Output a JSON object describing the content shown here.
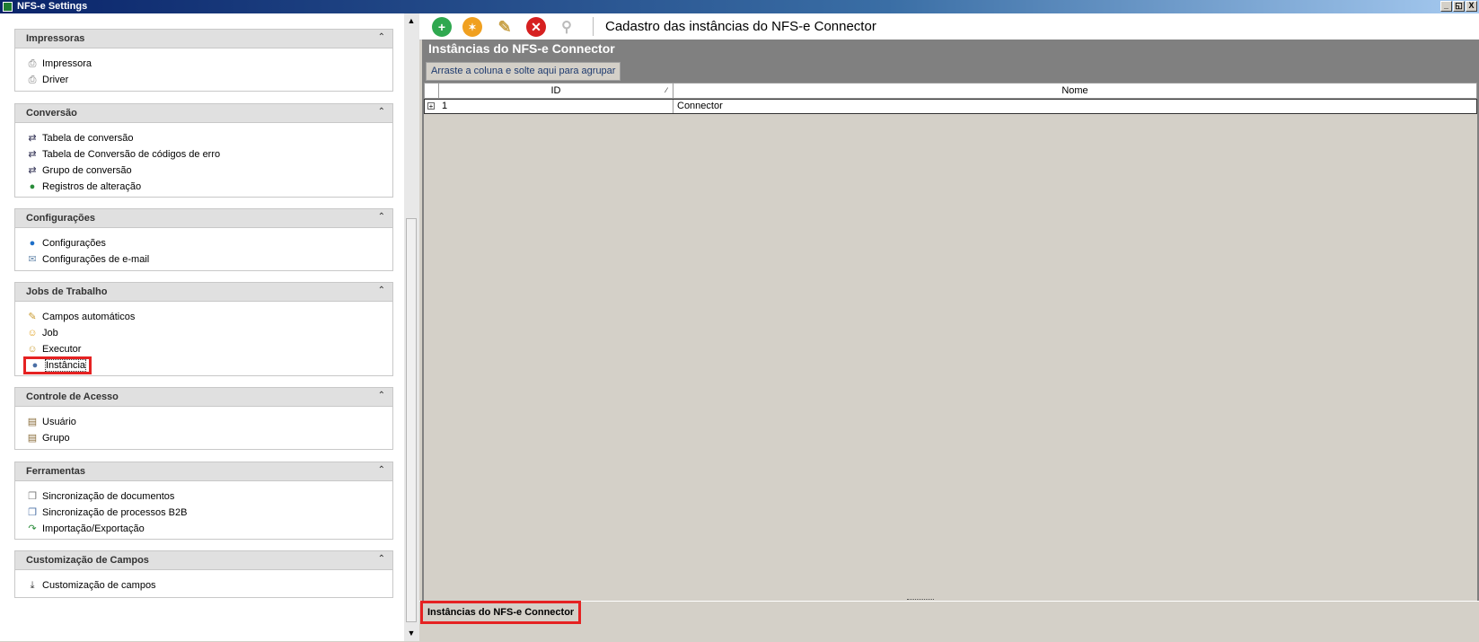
{
  "window": {
    "title": "NFS-e Settings",
    "controls": [
      "_",
      "◱",
      "X"
    ]
  },
  "sidebar": {
    "groups": [
      {
        "title": "Impressoras",
        "items": [
          {
            "label": "Impressora",
            "icon": "printer-icon"
          },
          {
            "label": "Driver",
            "icon": "driver-icon"
          }
        ]
      },
      {
        "title": "Conversão",
        "items": [
          {
            "label": "Tabela de conversão",
            "icon": "conversion-table-icon"
          },
          {
            "label": "Tabela de Conversão de códigos de erro",
            "icon": "error-code-table-icon"
          },
          {
            "label": "Grupo de conversão",
            "icon": "conversion-group-icon"
          },
          {
            "label": "Registros de alteração",
            "icon": "change-log-icon"
          }
        ]
      },
      {
        "title": "Configurações",
        "items": [
          {
            "label": "Configurações",
            "icon": "settings-icon"
          },
          {
            "label": "Configurações de e-mail",
            "icon": "email-settings-icon"
          }
        ]
      },
      {
        "title": "Jobs de Trabalho",
        "items": [
          {
            "label": "Campos automáticos",
            "icon": "auto-fields-icon"
          },
          {
            "label": "Job",
            "icon": "job-icon"
          },
          {
            "label": "Executor",
            "icon": "executor-icon"
          },
          {
            "label": "Instância",
            "icon": "instance-icon"
          }
        ]
      },
      {
        "title": "Controle de Acesso",
        "items": [
          {
            "label": "Usuário",
            "icon": "user-icon"
          },
          {
            "label": "Grupo",
            "icon": "group-icon"
          }
        ]
      },
      {
        "title": "Ferramentas",
        "items": [
          {
            "label": "Sincronização de documentos",
            "icon": "document-sync-icon"
          },
          {
            "label": "Sincronização de processos B2B",
            "icon": "b2b-sync-icon"
          },
          {
            "label": "Importação/Exportação",
            "icon": "import-export-icon"
          }
        ]
      },
      {
        "title": "Customização de Campos",
        "items": [
          {
            "label": "Customização de campos",
            "icon": "field-customization-icon"
          }
        ]
      }
    ],
    "collapse_glyph": "»"
  },
  "toolbar": {
    "title": "Cadastro das instâncias do NFS-e Connector",
    "buttons": [
      {
        "icon": "add-icon",
        "color": "#2fa84f"
      },
      {
        "icon": "copy-icon",
        "color": "#f0a020"
      },
      {
        "icon": "edit-icon",
        "color": "#c9a24a"
      },
      {
        "icon": "delete-icon",
        "color": "#d62020"
      },
      {
        "icon": "search-icon",
        "color": "#bbbbbb"
      }
    ]
  },
  "grid": {
    "panel_title": "Instâncias do NFS-e Connector",
    "group_by_hint": "Arraste a coluna e solte aqui para agrupar",
    "columns": [
      "ID",
      "Nome"
    ],
    "rows": [
      {
        "id": "1",
        "nome": "Connector"
      }
    ]
  },
  "bottom_tab": {
    "label": "Instâncias do NFS-e Connector"
  }
}
